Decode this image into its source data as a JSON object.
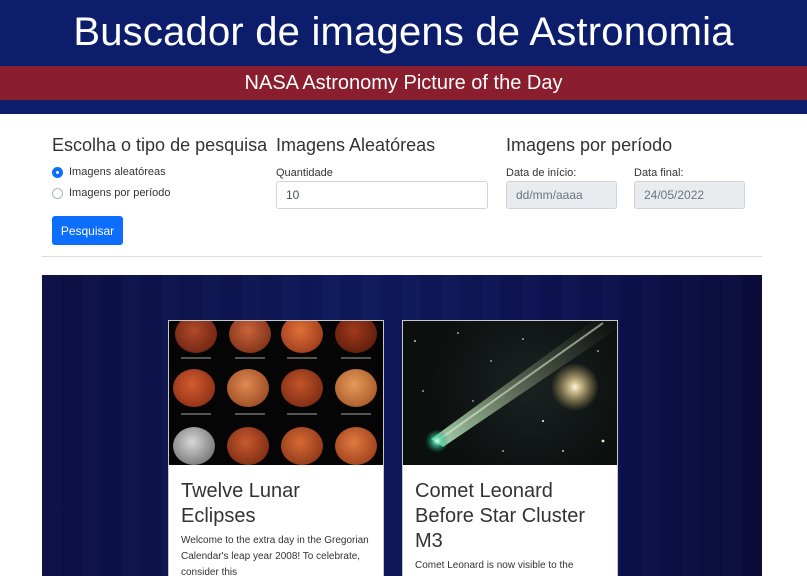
{
  "header": {
    "title": "Buscador de imagens de Astronomia",
    "subtitle": "NASA Astronomy Picture of the Day"
  },
  "search": {
    "type_title": "Escolha o tipo de pesquisa",
    "options": [
      "Imagens aleatóreas",
      "Imagens por período"
    ],
    "selected": "Imagens aleatóreas",
    "button_label": "Pesquisar"
  },
  "random": {
    "title": "Imagens Aleatóreas",
    "quantity_label": "Quantidade",
    "quantity_value": "10"
  },
  "period": {
    "title": "Imagens por período",
    "start_label": "Data de início:",
    "start_placeholder": "dd/mm/aaaa",
    "end_label": "Data final:",
    "end_value": "24/05/2022"
  },
  "cards": [
    {
      "title": "Twelve Lunar Eclipses",
      "text": "Welcome to the extra day in the Gregorian Calendar's leap year 2008! To celebrate, consider this",
      "image": "lunar-eclipses-grid"
    },
    {
      "title": "Comet Leonard Before Star Cluster M3",
      "text": "Comet Leonard is now visible to the",
      "image": "comet-with-star-cluster"
    }
  ],
  "colors": {
    "header_bg": "#0b1d6b",
    "header_band": "#8b1e2e",
    "primary": "#0d6efd",
    "gallery_bg": "#0d1250"
  }
}
